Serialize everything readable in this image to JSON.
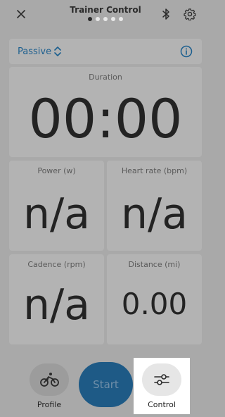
{
  "header": {
    "title": "Trainer Control",
    "page_dots": 5,
    "active_dot": 0,
    "close_icon": "close-icon",
    "bluetooth_icon": "bluetooth-icon",
    "settings_icon": "gear-icon"
  },
  "mode": {
    "selected": "Passive",
    "info_icon": "info-icon"
  },
  "metrics": {
    "duration": {
      "label": "Duration",
      "value": "00:00"
    },
    "power": {
      "label": "Power (w)",
      "value": "n/a"
    },
    "heart_rate": {
      "label": "Heart rate (bpm)",
      "value": "n/a"
    },
    "cadence": {
      "label": "Cadence (rpm)",
      "value": "n/a"
    },
    "distance": {
      "label": "Distance (mi)",
      "value": "0.00"
    }
  },
  "bottom_nav": {
    "profile_label": "Profile",
    "start_label": "Start",
    "control_label": "Control"
  },
  "colors": {
    "accent": "#1c5f8f",
    "start_button": "#1e5a86",
    "background": "#a9a9a9",
    "card": "#b3b3b3"
  }
}
